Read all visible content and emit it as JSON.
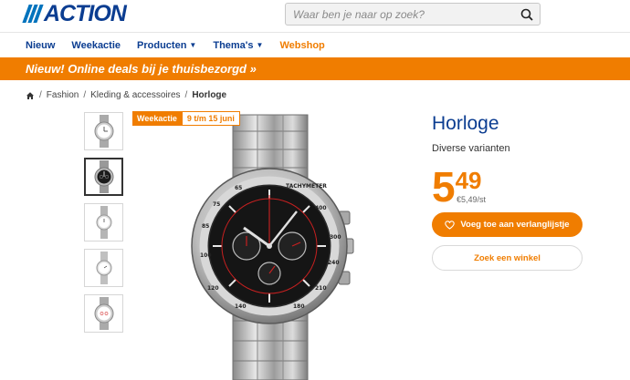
{
  "header": {
    "logo_text": "ACTION",
    "search_placeholder": "Waar ben je naar op zoek?"
  },
  "nav": {
    "items": [
      {
        "label": "Nieuw",
        "dropdown": false
      },
      {
        "label": "Weekactie",
        "dropdown": false
      },
      {
        "label": "Producten",
        "dropdown": true
      },
      {
        "label": "Thema's",
        "dropdown": true
      },
      {
        "label": "Webshop",
        "dropdown": false
      }
    ]
  },
  "banner": {
    "text": "Nieuw! Online deals bij je thuisbezorgd »"
  },
  "breadcrumb": {
    "items": [
      "Fashion",
      "Kleding & accessoires"
    ],
    "current": "Horloge"
  },
  "badge": {
    "label": "Weekactie",
    "period": "9 t/m 15 juni"
  },
  "product": {
    "title": "Horloge",
    "subtitle": "Diverse varianten",
    "price_euro": "5",
    "price_cents": "49",
    "unit_price": "€5,49/st",
    "wishlist_label": "Voeg toe aan verlanglijstje",
    "store_label": "Zoek een winkel"
  },
  "colors": {
    "brand_blue": "#0b3d91",
    "accent_orange": "#f07d00"
  }
}
